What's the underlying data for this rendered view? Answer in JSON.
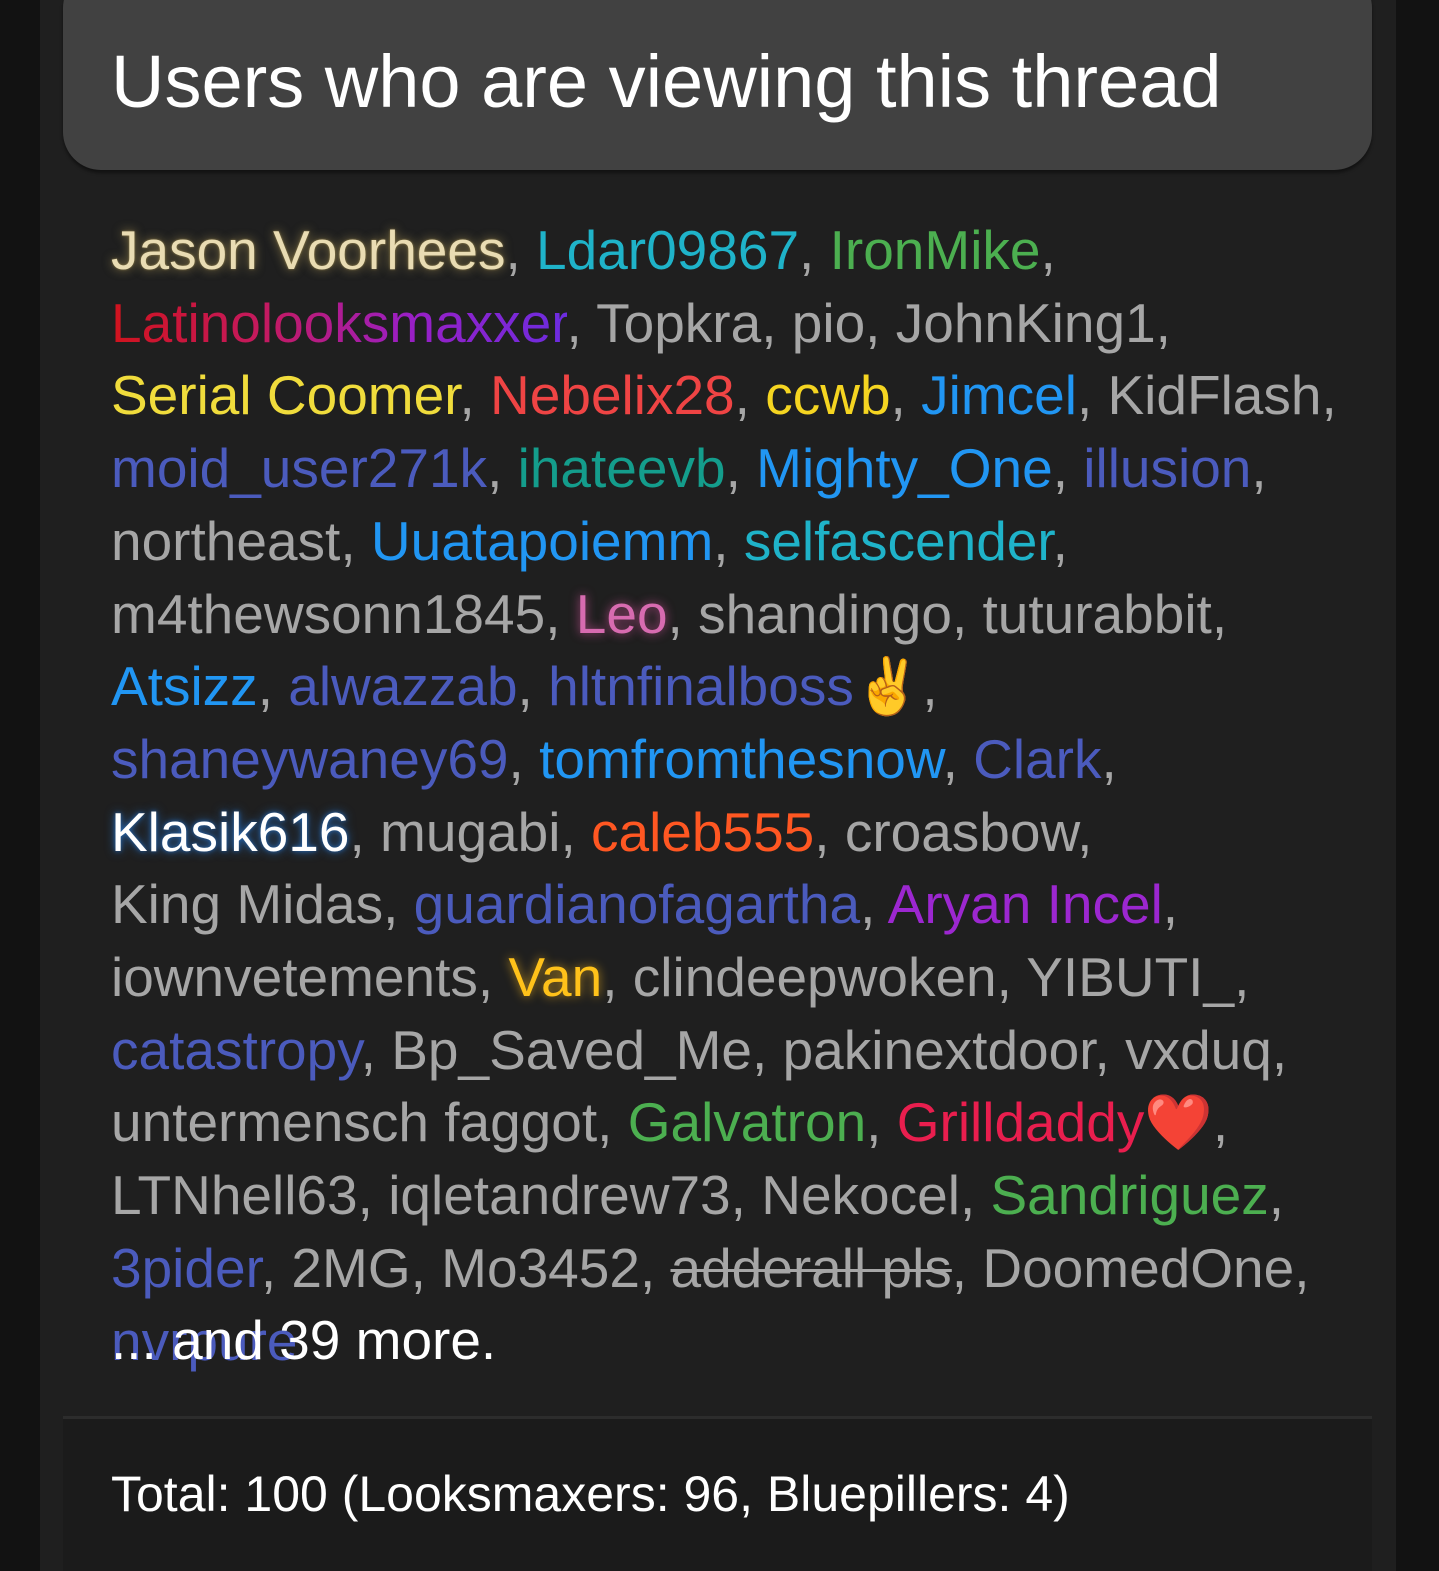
{
  "header": {
    "title": "Users who are viewing this thread"
  },
  "viewers": [
    {
      "name": "Jason Voorhees",
      "color": "#e9dcb3",
      "style": "glow-cream"
    },
    {
      "name": "Ldar09867",
      "color": "#1fb3c9"
    },
    {
      "name": "IronMike",
      "color": "#4caf50"
    },
    {
      "name": "Latinolooksmaxxer",
      "color": "#c2185b",
      "style": "gradient-text"
    },
    {
      "name": "Topkra",
      "color": "#a6a6a6"
    },
    {
      "name": "pio",
      "color": "#a6a6a6"
    },
    {
      "name": "JohnKing1",
      "color": "#a6a6a6"
    },
    {
      "name": "Serial Coomer",
      "color": "#f0dc3c"
    },
    {
      "name": "Nebelix28",
      "color": "#ef4444"
    },
    {
      "name": "ccwb",
      "color": "#f5d521"
    },
    {
      "name": "Jimcel",
      "color": "#2196f3"
    },
    {
      "name": "KidFlash",
      "color": "#a6a6a6"
    },
    {
      "name": "moid_user271k",
      "color": "#4b5bbd"
    },
    {
      "name": "ihateevb",
      "color": "#149d8c"
    },
    {
      "name": "Mighty_One",
      "color": "#2196f3"
    },
    {
      "name": "illusion",
      "color": "#4b5bbd"
    },
    {
      "name": "northeast",
      "color": "#a6a6a6"
    },
    {
      "name": "Uuatapoiemm",
      "color": "#2196f3"
    },
    {
      "name": "selfascender",
      "color": "#1fb3c9"
    },
    {
      "name": "m4thewsonn1845",
      "color": "#a6a6a6"
    },
    {
      "name": "Leo",
      "color": "#d76bb0",
      "style": "glow-pink"
    },
    {
      "name": "shandingo",
      "color": "#a6a6a6"
    },
    {
      "name": "tuturabbit",
      "color": "#a6a6a6"
    },
    {
      "name": "Atsizz",
      "color": "#2196f3"
    },
    {
      "name": "alwazzab",
      "color": "#4b5bbd"
    },
    {
      "name": "hltnfinalboss✌️",
      "color": "#4b5bbd"
    },
    {
      "name": "shaneywaney69",
      "color": "#4b5bbd"
    },
    {
      "name": "tomfromthesnow",
      "color": "#2196f3"
    },
    {
      "name": "Clark",
      "color": "#4b5bbd"
    },
    {
      "name": "Klasik616",
      "color": "#ffffff",
      "style": "glow-navy"
    },
    {
      "name": "mugabi",
      "color": "#a6a6a6"
    },
    {
      "name": "caleb555",
      "color": "#ff5722"
    },
    {
      "name": "croasbow",
      "color": "#a6a6a6"
    },
    {
      "name": "King Midas",
      "color": "#a6a6a6"
    },
    {
      "name": "guardianofagartha",
      "color": "#4b5bbd"
    },
    {
      "name": "Aryan Incel",
      "color": "#9c27d0"
    },
    {
      "name": "iownvetements",
      "color": "#a6a6a6"
    },
    {
      "name": "Van",
      "color": "#ffc21a",
      "style": "glow-gold"
    },
    {
      "name": "clindeepwoken",
      "color": "#a6a6a6"
    },
    {
      "name": "YIBUTI_",
      "color": "#a6a6a6"
    },
    {
      "name": "catastropy",
      "color": "#4b5bbd"
    },
    {
      "name": "Bp_Saved_Me",
      "color": "#a6a6a6"
    },
    {
      "name": "pakinextdoor",
      "color": "#a6a6a6"
    },
    {
      "name": "vxduq",
      "color": "#a6a6a6"
    },
    {
      "name": "untermensch faggot",
      "color": "#a6a6a6"
    },
    {
      "name": "Galvatron",
      "color": "#4caf50"
    },
    {
      "name": "Grilldaddy❤️",
      "color": "#e91e4e"
    },
    {
      "name": "LTNhell63",
      "color": "#a6a6a6"
    },
    {
      "name": "iqletandrew73",
      "color": "#a6a6a6"
    },
    {
      "name": "Nekocel",
      "color": "#a6a6a6"
    },
    {
      "name": "Sandriguez",
      "color": "#4caf50"
    },
    {
      "name": "3pider",
      "color": "#4b5bbd"
    },
    {
      "name": "2MG",
      "color": "#a6a6a6"
    },
    {
      "name": "Mo3452",
      "color": "#a6a6a6"
    },
    {
      "name": "adderall pls",
      "color": "#a6a6a6",
      "style": "strike"
    },
    {
      "name": "DoomedOne",
      "color": "#a6a6a6"
    },
    {
      "name": "nvrpure",
      "color": "#4b5bbd"
    }
  ],
  "more_text": "... and 39 more.",
  "footer": {
    "total_text": "Total: 100 (Looksmaxers: 96, Bluepillers: 4)"
  }
}
